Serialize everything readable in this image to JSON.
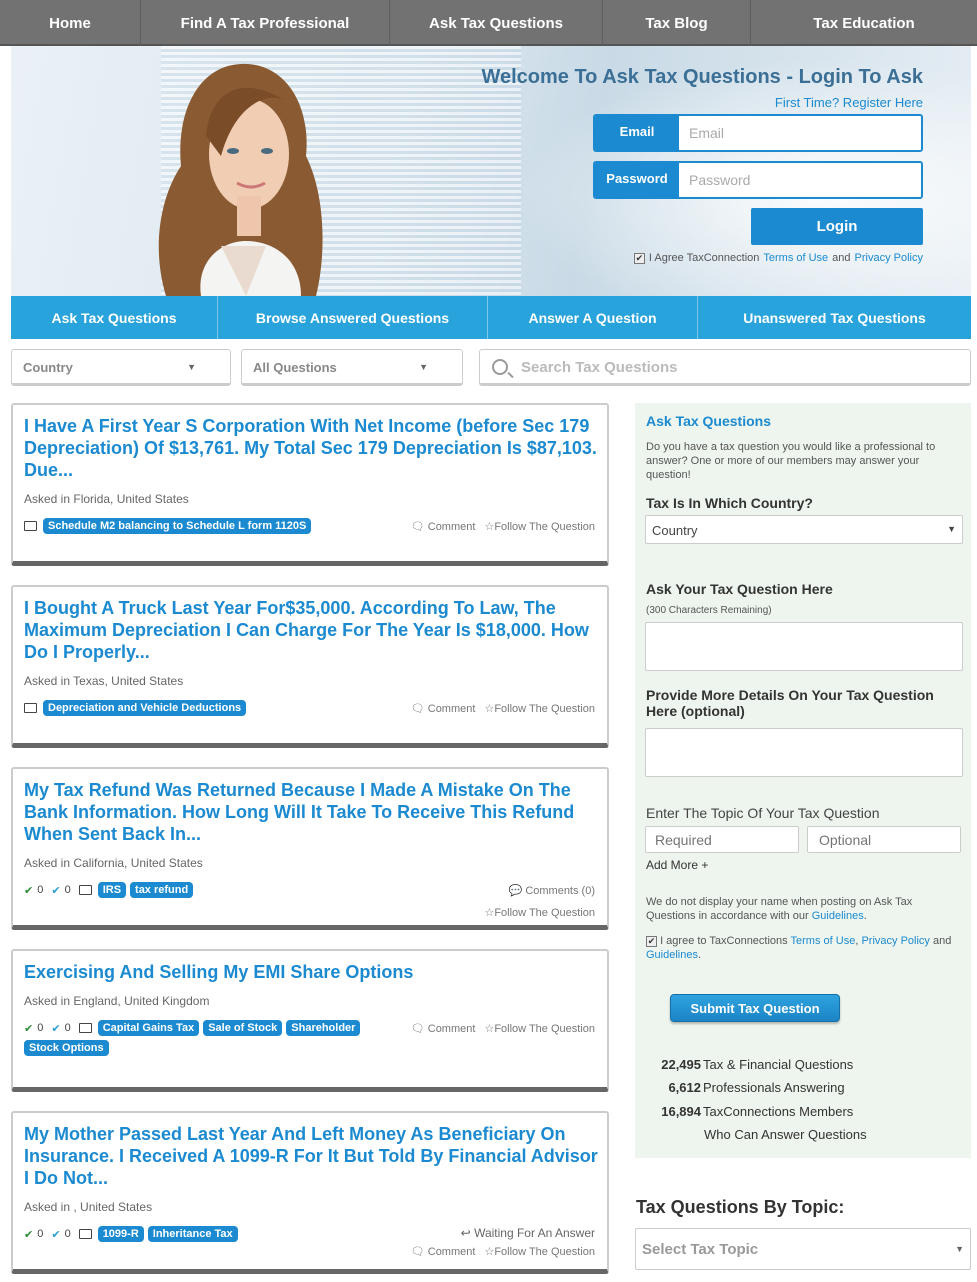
{
  "topnav": [
    "Home",
    "Find A Tax Professional",
    "Ask Tax Questions",
    "Tax Blog",
    "Tax Education"
  ],
  "hero": {
    "title": "Welcome To Ask Tax Questions - Login To Ask",
    "register": "First Time? Register Here",
    "email_label": "Email",
    "email_placeholder": "Email",
    "password_label": "Password",
    "password_placeholder": "Password",
    "login": "Login",
    "agree_prefix": "I Agree TaxConnection",
    "terms": "Terms of Use",
    "and": "and",
    "privacy": "Privacy Policy"
  },
  "subnav": [
    "Ask Tax Questions",
    "Browse Answered Questions",
    "Answer A Question",
    "Unanswered Tax Questions"
  ],
  "filters": {
    "country": "Country",
    "questions": "All Questions",
    "search_placeholder": "Search Tax Questions"
  },
  "questions": [
    {
      "title": "I Have A First Year S Corporation With Net Income (before Sec 179 Depreciation) Of $13,761. My Total Sec 179 Depreciation Is $87,103. Due...",
      "location": "Asked in Florida, United States",
      "tags": [
        "Schedule M2 balancing to Schedule L form 1120S"
      ],
      "comment": "Comment",
      "follow": "Follow The Question"
    },
    {
      "title": "I Bought A Truck Last Year For$35,000. According To Law, The Maximum Depreciation I Can Charge For The Year Is $18,000. How Do I Properly...",
      "location": "Asked in Texas, United States",
      "tags": [
        "Depreciation and Vehicle Deductions"
      ],
      "comment": "Comment",
      "follow": "Follow The Question"
    },
    {
      "title": "My Tax Refund Was Returned Because I Made A Mistake On The Bank Information. How Long Will It Take To Receive This Refund When Sent Back In...",
      "location": "Asked in California, United States",
      "answers": "0",
      "votes": "0",
      "tags": [
        "IRS",
        "tax refund"
      ],
      "comment": "Comments (0)",
      "follow": "Follow The Question"
    },
    {
      "title": "Exercising And Selling My EMI Share Options",
      "location": "Asked in England, United Kingdom",
      "answers": "0",
      "votes": "0",
      "tags": [
        "Capital Gains Tax",
        "Sale of Stock",
        "Shareholder",
        "Stock Options"
      ],
      "comment": "Comment",
      "follow": "Follow The Question"
    },
    {
      "title": "My Mother Passed Last Year And Left Money As Beneficiary On Insurance. I Received A 1099-R For It But Told By Financial Advisor I Do Not...",
      "location": "Asked in , United States",
      "answers": "0",
      "votes": "0",
      "tags": [
        "1099-R",
        "Inheritance Tax"
      ],
      "waiting": "Waiting For An Answer",
      "comment": "Comment",
      "follow": "Follow The Question"
    }
  ],
  "sidebar": {
    "title": "Ask Tax Questions",
    "intro": "Do you have a tax question you would like a professional to answer? One or more of our members may answer your question!",
    "country_label": "Tax Is In Which Country?",
    "country_value": "Country",
    "question_label": "Ask Your Tax Question Here",
    "remaining": "(300 Characters Remaining)",
    "details_label": "Provide More Details On Your Tax Question Here (optional)",
    "topic_label": "Enter The Topic Of Your Tax Question",
    "required_placeholder": "Required",
    "optional_placeholder": "Optional",
    "add_more": "Add More +",
    "privacy_note": "We do not display your name when posting on Ask Tax Questions in accordance with our",
    "guidelines": "Guidelines",
    "agree_prefix": "I agree to TaxConnections",
    "terms": "Terms of Use",
    "privacy": "Privacy Policy",
    "and": "and",
    "submit": "Submit Tax Question",
    "stats": [
      {
        "num": "22,495",
        "label": "Tax & Financial Questions"
      },
      {
        "num": "6,612",
        "label": "Professionals Answering"
      },
      {
        "num": "16,894",
        "label": "TaxConnections Members"
      }
    ],
    "stats_footer": "Who Can Answer Questions"
  },
  "topics": {
    "title": "Tax Questions By Topic:",
    "select": "Select Tax Topic"
  }
}
